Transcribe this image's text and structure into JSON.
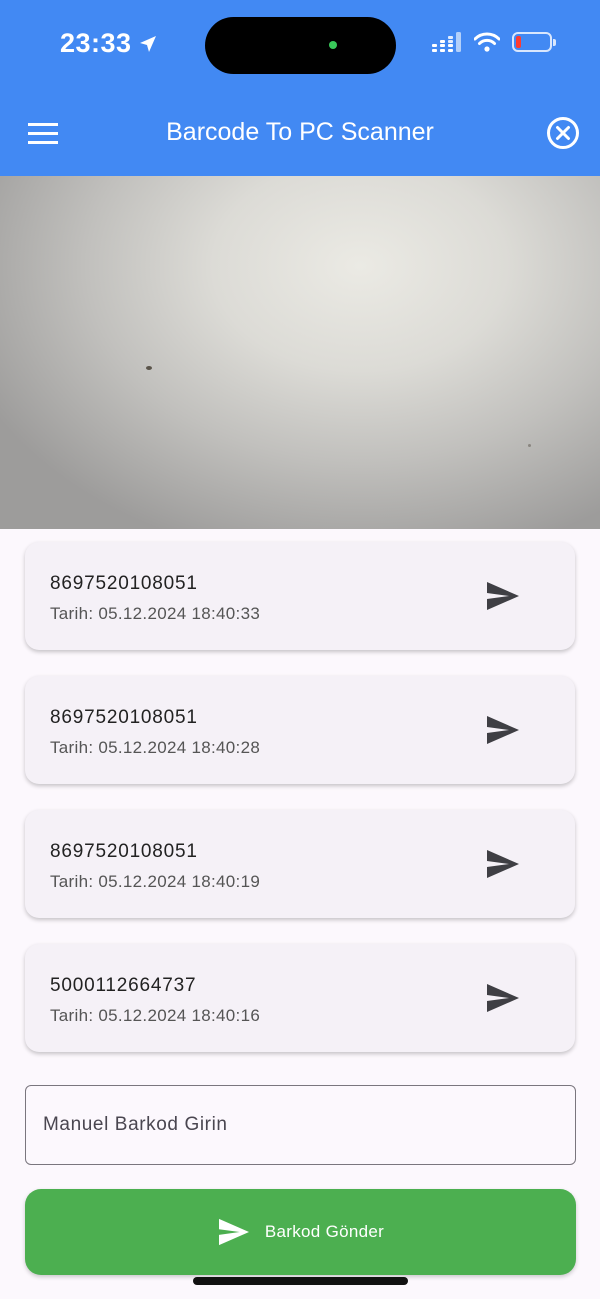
{
  "status_bar": {
    "time": "23:33",
    "location_icon": "location-arrow-icon",
    "signal_icon": "cellular-signal-icon",
    "wifi_icon": "wifi-icon",
    "battery_icon": "battery-low-icon",
    "battery_level_fraction": 0.1
  },
  "app_bar": {
    "title": "Barcode To PC Scanner",
    "menu_icon": "menu-icon",
    "close_icon": "close-circle-icon",
    "color": "#4289f3"
  },
  "camera_preview": {
    "label": "camera-preview"
  },
  "scans": [
    {
      "code": "8697520108051",
      "date": "Tarih: 05.12.2024 18:40:33"
    },
    {
      "code": "8697520108051",
      "date": "Tarih: 05.12.2024 18:40:28"
    },
    {
      "code": "8697520108051",
      "date": "Tarih: 05.12.2024 18:40:19"
    },
    {
      "code": "5000112664737",
      "date": "Tarih: 05.12.2024 18:40:16"
    }
  ],
  "manual_input": {
    "placeholder": "Manuel Barkod Girin",
    "value": ""
  },
  "send_button": {
    "label": "Barkod Gönder",
    "icon": "send-icon",
    "color": "#4caf50"
  }
}
